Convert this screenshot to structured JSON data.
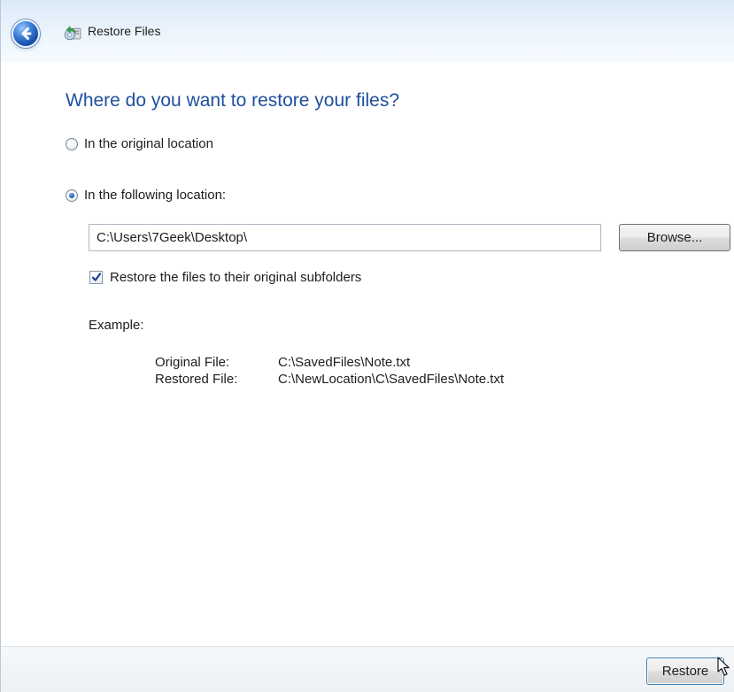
{
  "window": {
    "title": "Restore Files",
    "back_icon": "back-arrow-icon",
    "app_icon": "restore-files-icon"
  },
  "main": {
    "heading": "Where do you want to restore your files?",
    "options": [
      {
        "label": "In the original location",
        "selected": false
      },
      {
        "label": "In the following location:",
        "selected": true
      }
    ],
    "location_value": "C:\\Users\\7Geek\\Desktop\\",
    "browse_label": "Browse...",
    "checkbox_label": "Restore the files to their original subfolders",
    "checkbox_checked": true,
    "example": {
      "label": "Example:",
      "rows": [
        {
          "name": "Original File:",
          "value": "C:\\SavedFiles\\Note.txt"
        },
        {
          "name": "Restored File:",
          "value": "C:\\NewLocation\\C\\SavedFiles\\Note.txt"
        }
      ]
    }
  },
  "footer": {
    "restore_label": "Restore"
  },
  "icons": {
    "back": "back-arrow-icon",
    "restore": "restore-files-icon",
    "radio": "radio-button",
    "checkbox": "checkbox-check",
    "cursor": "mouse-pointer-icon"
  },
  "colors": {
    "heading_blue": "#1f4f9e",
    "titlebar_top": "#dce9f7",
    "footer_bg": "#edf1f4",
    "button_border": "#707070",
    "accent_blue": "#2f67bd"
  }
}
